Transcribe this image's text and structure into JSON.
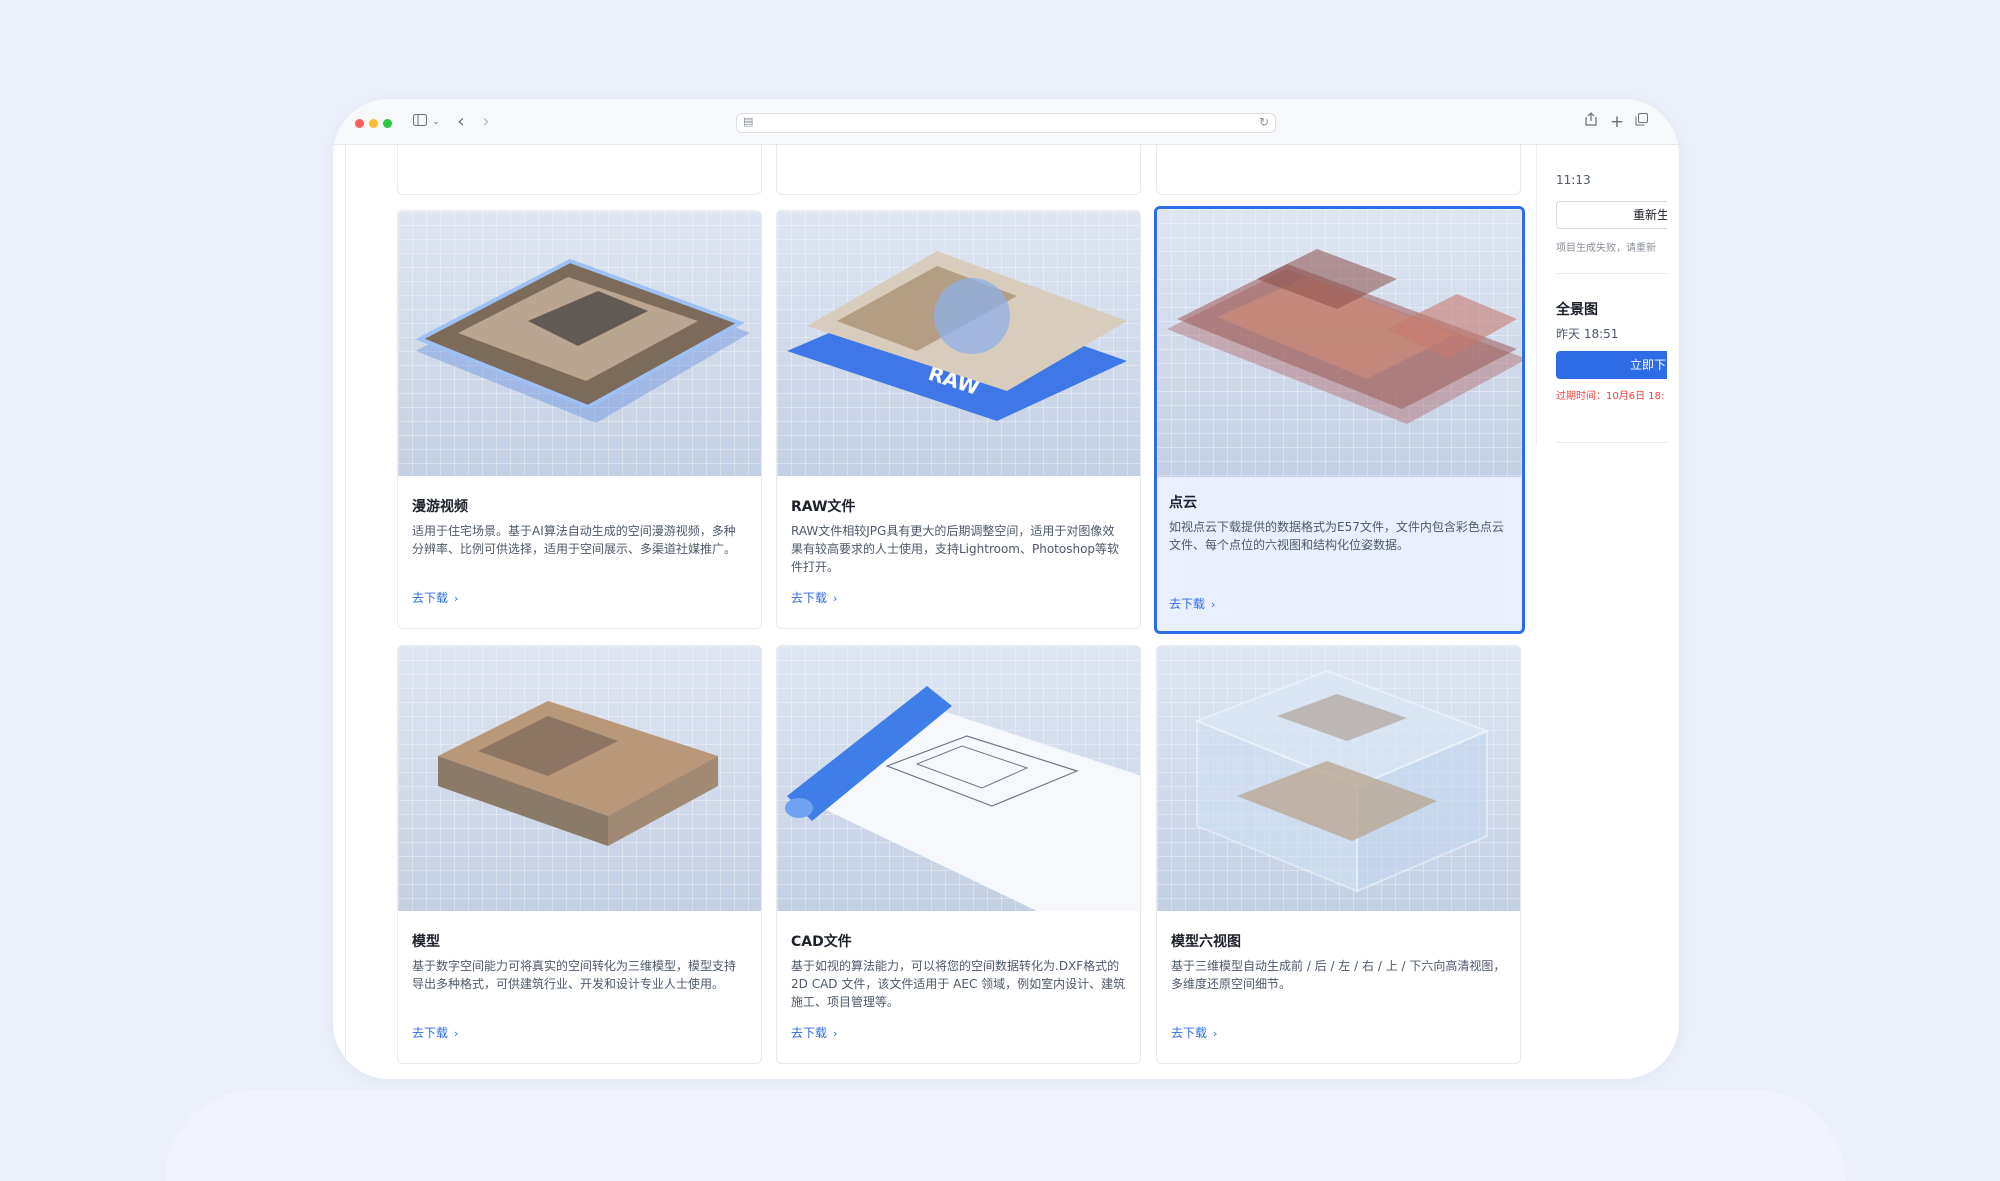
{
  "browser": {
    "icons": [
      "sidebar-icon",
      "chevron-down-icon",
      "back-icon",
      "forward-icon",
      "site-icon",
      "reload-icon",
      "share-icon",
      "new-tab-icon",
      "tabs-icon"
    ]
  },
  "cards": [
    {
      "title": "漫游视频",
      "desc": "适用于住宅场景。基于AI算法自动生成的空间漫游视频，多种分辨率、比例可供选择，适用于空间展示、多渠道社媒推广。",
      "link": "去下载"
    },
    {
      "title": "RAW文件",
      "desc": "RAW文件相较JPG具有更大的后期调整空间，适用于对图像效果有较高要求的人士使用，支持Lightroom、Photoshop等软件打开。",
      "link": "去下载",
      "badge": "RAW"
    },
    {
      "title": "点云",
      "desc": "如视点云下载提供的数据格式为E57文件，文件内包含彩色点云文件、每个点位的六视图和结构化位姿数据。",
      "link": "去下载",
      "selected": true
    },
    {
      "title": "模型",
      "desc": "基于数字空间能力可将真实的空间转化为三维模型，模型支持导出多种格式，可供建筑行业、开发和设计专业人士使用。",
      "link": "去下载"
    },
    {
      "title": "CAD文件",
      "desc": "基于如视的算法能力，可以将您的空间数据转化为.DXF格式的 2D CAD 文件，该文件适用于 AEC 领域，例如室内设计、建筑施工、项目管理等。",
      "link": "去下载"
    },
    {
      "title": "模型六视图",
      "desc": "基于三维模型自动生成前 / 后 / 左 / 右 / 上 / 下六向高清视图，多维度还原空间细节。",
      "link": "去下载"
    }
  ],
  "side": {
    "time1": "11:13",
    "regen_button": "重新生",
    "fail_note": "项目生成失败，请重新",
    "panorama_title": "全景图",
    "panorama_time": "昨天 18:51",
    "download_button": "立即下",
    "expire_note": "过期时间：10月6日 18:"
  },
  "colors": {
    "accent": "#2e6be6",
    "selected_bg": "#e9efff",
    "warning": "#f53f3f"
  }
}
